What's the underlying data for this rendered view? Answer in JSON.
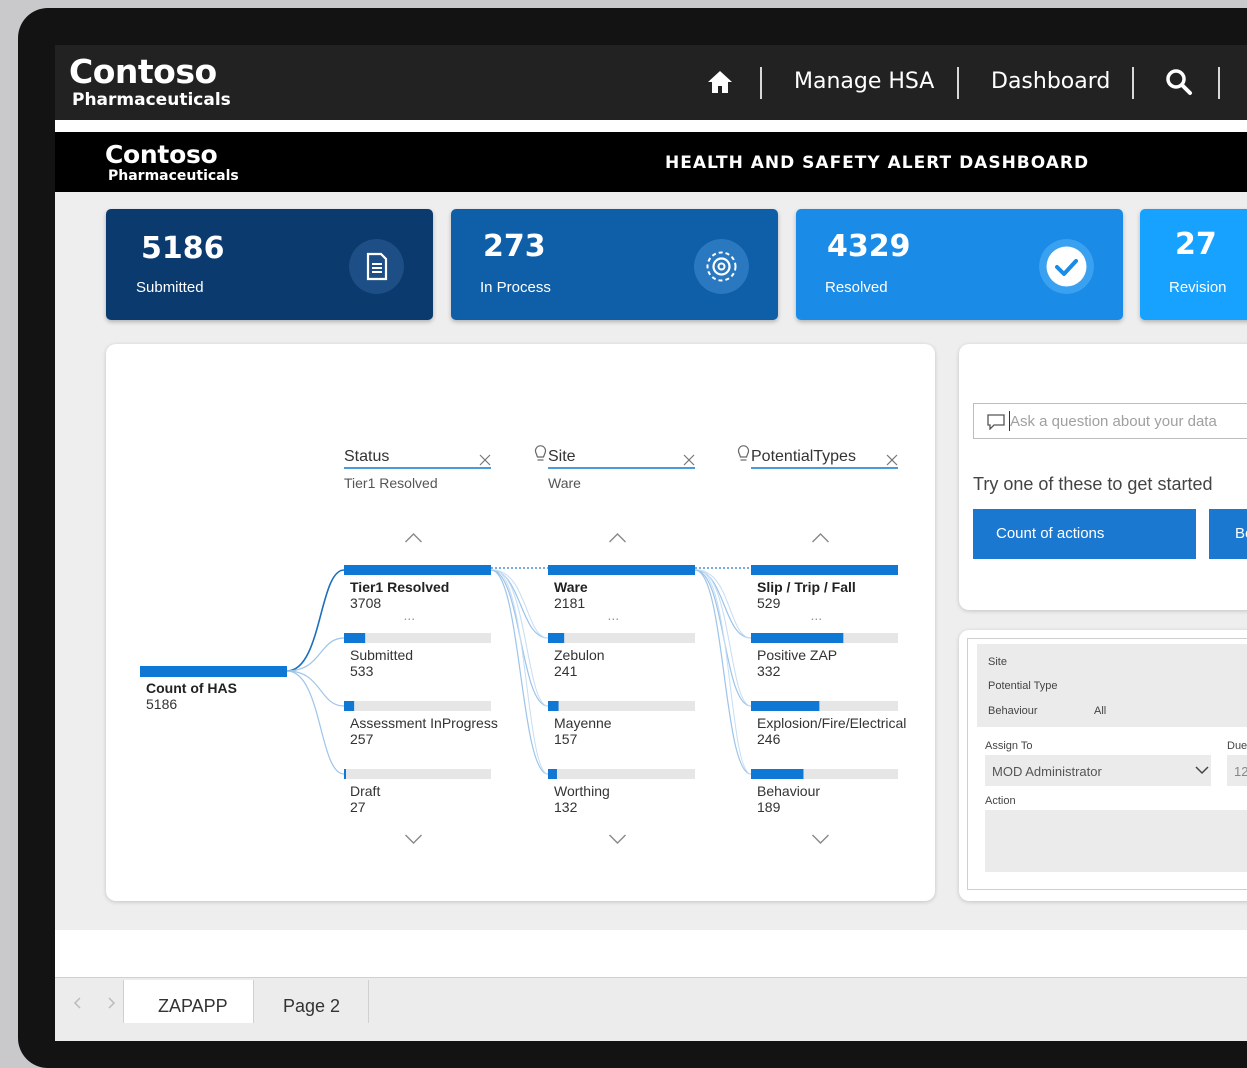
{
  "topnav": {
    "brand_main": "Contoso",
    "brand_sub": "Pharmaceuticals",
    "home_icon": "home-icon",
    "links": [
      "Manage HSA",
      "Dashboard"
    ],
    "search_icon": "search-icon"
  },
  "report": {
    "brand_main": "Contoso",
    "brand_sub": "Pharmaceuticals",
    "title": "HEALTH AND SAFETY ALERT DASHBOARD"
  },
  "kpis": [
    {
      "value": "5186",
      "label": "Submitted",
      "icon": "document-icon",
      "color": "#0b3a6e"
    },
    {
      "value": "273",
      "label": "In Process",
      "icon": "gear-icon",
      "color": "#0f5ea8"
    },
    {
      "value": "4329",
      "label": "Resolved",
      "icon": "check-icon",
      "color": "#1a8be6"
    },
    {
      "value": "27",
      "label": "Revision",
      "icon": "revision-icon",
      "color": "#17a2ff"
    }
  ],
  "tree": {
    "root": {
      "label": "Count of HAS",
      "value": "5186"
    },
    "levels": [
      {
        "name": "Status",
        "filter": "Tier1 Resolved",
        "bulb": false,
        "nodes": [
          {
            "label": "Tier1 Resolved",
            "value": "3708",
            "fraction": 1.0,
            "selected": true
          },
          {
            "label": "Submitted",
            "value": "533",
            "fraction": 0.144
          },
          {
            "label": "Assessment InProgress",
            "value": "257",
            "fraction": 0.069
          },
          {
            "label": "Draft",
            "value": "27",
            "fraction": 0.007
          }
        ]
      },
      {
        "name": "Site",
        "filter": "Ware",
        "bulb": true,
        "nodes": [
          {
            "label": "Ware",
            "value": "2181",
            "fraction": 1.0,
            "selected": true
          },
          {
            "label": "Zebulon",
            "value": "241",
            "fraction": 0.11
          },
          {
            "label": "Mayenne",
            "value": "157",
            "fraction": 0.072
          },
          {
            "label": "Worthing",
            "value": "132",
            "fraction": 0.061
          }
        ]
      },
      {
        "name": "PotentialTypes",
        "filter": "",
        "bulb": true,
        "nodes": [
          {
            "label": "Slip / Trip / Fall",
            "value": "529",
            "fraction": 1.0,
            "selected": true
          },
          {
            "label": "Positive ZAP",
            "value": "332",
            "fraction": 0.628
          },
          {
            "label": "Explosion/Fire/Electrical",
            "value": "246",
            "fraction": 0.465
          },
          {
            "label": "Behaviour",
            "value": "189",
            "fraction": 0.357
          }
        ]
      }
    ],
    "more_glyph": "...",
    "up_icon": "chevron-up-icon",
    "down_icon": "chevron-down-icon",
    "close_icon": "close-icon"
  },
  "qna": {
    "placeholder": "Ask a question about your data",
    "hint": "Try one of these to get started",
    "suggestions": [
      "Count of actions",
      "Be"
    ]
  },
  "form": {
    "site_label": "Site",
    "potential_type_label": "Potential Type",
    "behaviour_label": "Behaviour",
    "behaviour_value": "All",
    "assign_label": "Assign To",
    "assign_value": "MOD Administrator",
    "due_label": "Due",
    "due_value": "12",
    "action_label": "Action"
  },
  "pages": {
    "tabs": [
      "ZAPAPP",
      "Page 2"
    ],
    "active": 0
  },
  "colors": {
    "accent": "#1a78d0",
    "bar": "#0f78d4",
    "bar_bg": "#e6e6e6"
  }
}
